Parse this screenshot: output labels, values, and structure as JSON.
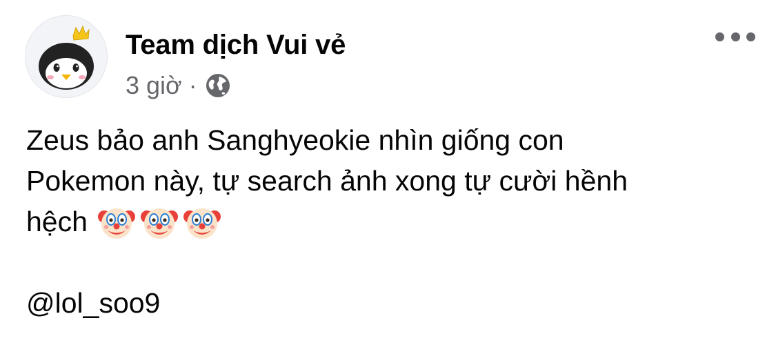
{
  "post": {
    "author": "Team dịch Vui vẻ",
    "time": "3 giờ",
    "separator": "·",
    "audience_icon": "globe-icon",
    "body_lines": [
      "Zeus bảo anh Sanghyeokie nhìn giống con",
      "Pokemon này, tự search ảnh xong tự cười hềnh",
      "hệch"
    ],
    "emojis": [
      "clown-face-emoji",
      "clown-face-emoji",
      "clown-face-emoji"
    ],
    "mention": "@lol_soo9"
  },
  "icons": {
    "avatar": "penguin-with-crown-avatar",
    "more": "more-options-icon"
  },
  "colors": {
    "text": "#050505",
    "secondary_text": "#65676b",
    "background": "#ffffff"
  }
}
